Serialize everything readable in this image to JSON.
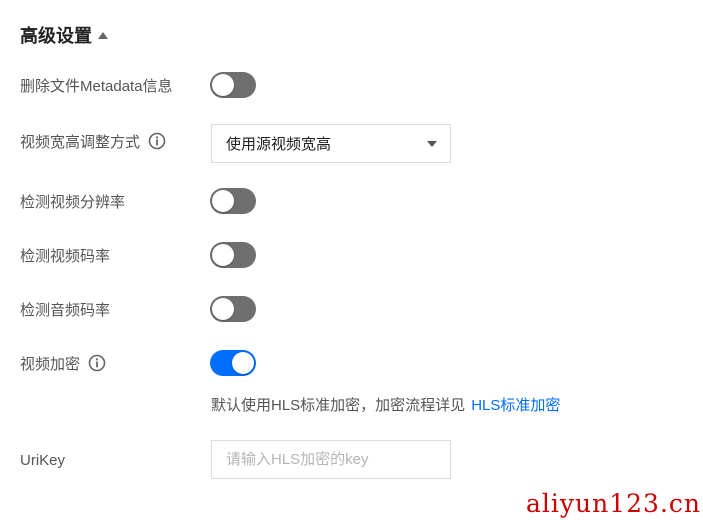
{
  "section": {
    "title": "高级设置",
    "collapse_icon": "caret-up-icon"
  },
  "rows": [
    {
      "label": "删除文件Metadata信息",
      "toggle_on": false
    },
    {
      "label": "视频宽高调整方式",
      "info_icon": "info-icon",
      "select_value": "使用源视频宽高"
    },
    {
      "label": "检测视频分辨率",
      "toggle_on": false
    },
    {
      "label": "检测视频码率",
      "toggle_on": false
    },
    {
      "label": "检测音频码率",
      "toggle_on": false
    },
    {
      "label": "视频加密",
      "info_icon": "info-icon",
      "toggle_on": true
    },
    {
      "label": "UriKey",
      "input_value": "",
      "input_placeholder": "请输入HLS加密的key"
    }
  ],
  "encryption_hint": {
    "text": "默认使用HLS标准加密，加密流程详见",
    "link": "HLS标准加密"
  },
  "colors": {
    "accent": "#006eff",
    "toggle_off": "#6f6f6f",
    "watermark": "#cc0000"
  },
  "watermark": "aliyun123.cn"
}
